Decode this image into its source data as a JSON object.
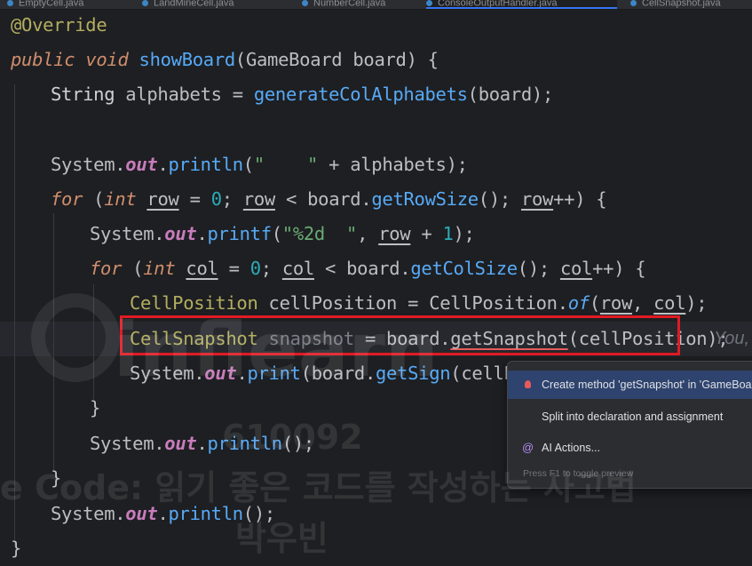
{
  "tabs": [
    {
      "label": "EmptyCell.java",
      "active": false
    },
    {
      "label": "LandMineCell.java",
      "active": false
    },
    {
      "label": "NumberCell.java",
      "active": false
    },
    {
      "label": "ConsoleOutputHandler.java",
      "active": true
    },
    {
      "label": "CellSnapshot.java",
      "active": false
    }
  ],
  "code": {
    "l1_annotation": "@Override",
    "l2_public": "public",
    "l2_void": "void",
    "l2_method": "showBoard",
    "l2_params": "(GameBoard board) {",
    "l3_type": "String",
    "l3_var": " alphabets = ",
    "l3_call": "generateColAlphabets",
    "l3_args": "(board);",
    "l5_system": "System.",
    "l5_out": "out",
    "l5_dot": ".",
    "l5_println": "println",
    "l5_open": "(",
    "l5_str": "\"    \"",
    "l5_rest": " + alphabets);",
    "l6_for": "for",
    "l6_open": " (",
    "l6_int": "int",
    "l6_sp": " ",
    "l6_row": "row",
    "l6_eq": " = ",
    "l6_zero": "0",
    "l6_semi": "; ",
    "l6_row2": "row",
    "l6_lt": " < board.",
    "l6_getrow": "getRowSize",
    "l6_mid": "(); ",
    "l6_row3": "row",
    "l6_end": "++) {",
    "l7_system": "System.",
    "l7_out": "out",
    "l7_dot": ".",
    "l7_printf": "printf",
    "l7_open": "(",
    "l7_str": "\"%2d  \"",
    "l7_comma": ", ",
    "l7_row": "row",
    "l7_plus": " + ",
    "l7_one": "1",
    "l7_end": ");",
    "l8_for": "for",
    "l8_open": " (",
    "l8_int": "int",
    "l8_sp": " ",
    "l8_col": "col",
    "l8_eq": " = ",
    "l8_zero": "0",
    "l8_semi": "; ",
    "l8_col2": "col",
    "l8_lt": " < board.",
    "l8_getcol": "getColSize",
    "l8_mid": "(); ",
    "l8_col3": "col",
    "l8_end": "++) {",
    "l9_type": "CellPosition",
    "l9_var": " cellPosition = CellPosition.",
    "l9_of": "of",
    "l9_open": "(",
    "l9_row": "row",
    "l9_comma": ", ",
    "l9_col": "col",
    "l9_end": ");",
    "l10_type": "CellSnapshot",
    "l10_var": " snapshot",
    "l10_eq": " = board.",
    "l10_method": "getSnapshot",
    "l10_args": "(cellPosition);",
    "l10_inlay": "You,",
    "l11_system": "System.",
    "l11_out": "out",
    "l11_dot": ".",
    "l11_print": "print",
    "l11_open": "(board.",
    "l11_getsign": "getSign",
    "l11_args": "(cellPos",
    "l12_brace": "}",
    "l13_system": "System.",
    "l13_out": "out",
    "l13_dot": ".",
    "l13_println": "println",
    "l13_end": "();",
    "l14_brace": "}",
    "l15_system": "System.",
    "l15_out": "out",
    "l15_dot": ".",
    "l15_println": "println",
    "l15_end": "();",
    "l16_brace": "}"
  },
  "popup": {
    "items": [
      {
        "label": "Create method 'getSnapshot' in 'GameBoa",
        "icon": "bulb-icon",
        "selected": true
      },
      {
        "label": "Split into declaration and assignment",
        "icon": "",
        "selected": false
      },
      {
        "label": "AI Actions...",
        "icon": "ai-actions-icon",
        "selected": false
      }
    ],
    "footer": "Press F1 to toggle preview"
  },
  "watermark": {
    "brand": "inflearn",
    "id": "610092",
    "course": "e Code: 읽기 좋은 코드를 작성하는 사고법",
    "author": "박우빈"
  },
  "colors": {
    "background": "#1e1f22",
    "keyword": "#cf8e6d",
    "method": "#57aaf7",
    "field": "#c77dbb",
    "string": "#6aab73",
    "number": "#2aacb8",
    "annotation": "#b3ae60",
    "highlight_box": "#e01b24",
    "popup_selected": "#2e436e"
  }
}
